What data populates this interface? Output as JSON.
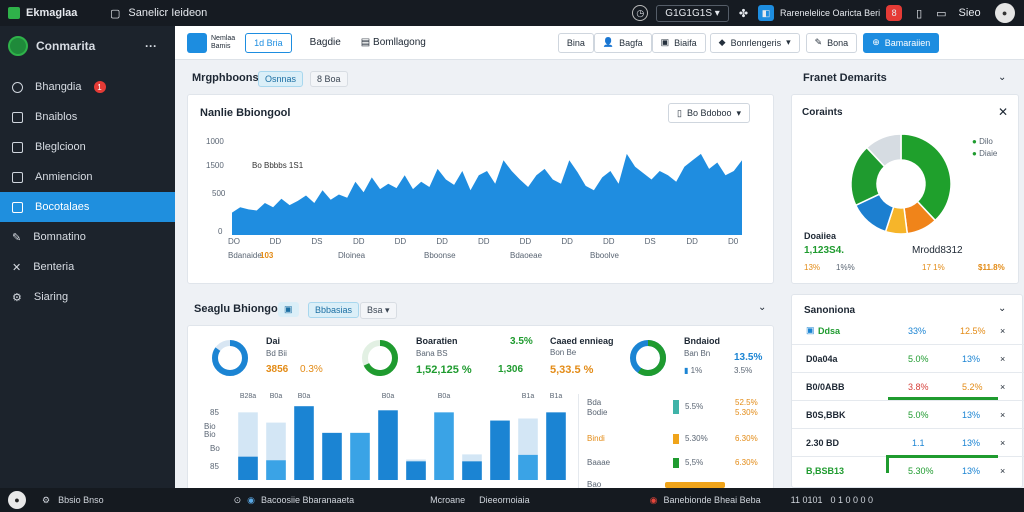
{
  "topbar": {
    "app_name": "Ekmaglaa",
    "search_label": "Sanelicr Ieideon",
    "dropdown_label": "G1G1G1S",
    "right_label": "Rarenelelice Oaricta Beri",
    "counter": "8",
    "user_label": "Sieo"
  },
  "sidebar": {
    "title": "Conmarita",
    "more": "···",
    "items": [
      {
        "label": "Bhangdia",
        "icon": "alert-icon",
        "badge": "1"
      },
      {
        "label": "Bnaiblos",
        "icon": "document-icon"
      },
      {
        "label": "Bleglcioon",
        "icon": "file-icon"
      },
      {
        "label": "Anmiencion",
        "icon": "box-icon"
      },
      {
        "label": "Bocotalaes",
        "icon": "chart-icon",
        "active": true
      },
      {
        "label": "Bomnatino",
        "icon": "tool-icon"
      },
      {
        "label": "Benteria",
        "icon": "cross-icon"
      },
      {
        "label": "Siaring",
        "icon": "gear-icon"
      }
    ]
  },
  "header": {
    "logo_line1": "Nemlaa",
    "logo_line2": "Bamis",
    "tab_active": "1d Bria",
    "tab2": "Bagdie",
    "tab3": "Bomllagong",
    "btn1": "Bina",
    "btn2": "Bagfa",
    "btn3": "Biaifa",
    "btn4": "Bonrlengeris",
    "btn5": "Bona",
    "primary_btn": "Bamaraiien"
  },
  "overview": {
    "title": "Mrgphboons",
    "chip1": "Osnnas",
    "chip2": "8 Boa",
    "panel_title": "Nanlie Bbiongool",
    "panel_select": "Bo Bdoboo",
    "y_ticks": [
      "1000",
      "1500",
      "500",
      "0"
    ],
    "annotation": "Bo Bbbbs 1S1",
    "x_ticks": [
      "DO",
      "DD",
      "DS",
      "DD",
      "DD",
      "DD",
      "DD",
      "DD",
      "DD",
      "DD",
      "DS",
      "DD",
      "D0"
    ],
    "footer_left": "Bdanaide",
    "footer_left_val": "103",
    "footer_mid": "Dloinea",
    "footer_r1": "Bboonse",
    "footer_r2": "Bdaoeae",
    "footer_r3": "Bboolve"
  },
  "chart_data": {
    "type": "area",
    "title": "Nanlie Bbiongool",
    "ylim": [
      0,
      1500
    ],
    "values": [
      210,
      260,
      240,
      230,
      300,
      260,
      340,
      280,
      320,
      370,
      300,
      420,
      330,
      380,
      350,
      500,
      400,
      540,
      430,
      480,
      440,
      560,
      430,
      500,
      450,
      620,
      520,
      470,
      600,
      420,
      560,
      600,
      480,
      700,
      600,
      520,
      450,
      560,
      620,
      520,
      480,
      700,
      590,
      460,
      420,
      540,
      600,
      480,
      760,
      640,
      580,
      520,
      600,
      560,
      500,
      640,
      700,
      760,
      620,
      680,
      560,
      600,
      700
    ]
  },
  "right_top": {
    "title": "Franet Demarits",
    "card_title": "Coraints",
    "legend1": "Dilo",
    "legend2": "Diaie",
    "legend1_color": "#1f9b2f",
    "legend2_color": "#1f9b2f",
    "slices": [
      {
        "value": 38,
        "color": "#1fa02c"
      },
      {
        "value": 10,
        "color": "#f0841a"
      },
      {
        "value": 7,
        "color": "#f6b52a"
      },
      {
        "value": 13,
        "color": "#1c7fd0"
      },
      {
        "value": 20,
        "color": "#1f9b2f"
      },
      {
        "value": 12,
        "color": "#d6dce2"
      }
    ],
    "stat_label1": "Doaiiea",
    "stat_val1": "1,123S4.",
    "stat_label2": "Mrodd8312",
    "sub1": "13%",
    "sub2": "1%%",
    "sub3": "17 1%",
    "sub4": "$11.8%"
  },
  "segments": {
    "title": "Seaglu Bhiongoo",
    "chip1": "Bbbasias",
    "chip2": "Bsa",
    "kpis": [
      {
        "label": "Dai",
        "sub": "Bd Bii",
        "v1": "3856",
        "v2": "0.3%",
        "ring": 85,
        "color": "#1b84d3"
      },
      {
        "label": "Boaratien",
        "sub": "Bana BS",
        "big": "1,52,125 %",
        "v1": "3.5%",
        "v2": "1,306",
        "ring": 68,
        "color": "#1f9b2f"
      },
      {
        "label": "Caaed ennieag",
        "sub": "Bon Be",
        "v1": "5,33.5 %",
        "ring": 0,
        "color": "#e38b16"
      },
      {
        "label": "Bndaiod",
        "sub": "Ban Bn",
        "v1": "13.5%",
        "v2": "3.5%",
        "v3": "1%",
        "ring": 60,
        "color": "#1f9b2f"
      }
    ]
  },
  "bars_data": {
    "type": "bar",
    "ylim": [
      0,
      80
    ],
    "y_ticks": [
      "85",
      "Bio",
      "Bio",
      "Bo",
      "85"
    ],
    "top_labels": [
      "B28a",
      "B0a",
      "B0a",
      "",
      "",
      "B0a",
      "",
      "B0a",
      "",
      "",
      "B1a",
      "B1a"
    ],
    "series": [
      {
        "name": "blue",
        "values": [
          65,
          55,
          72,
          46,
          46,
          68,
          52,
          66,
          52,
          58,
          70,
          66
        ]
      },
      {
        "name": "light",
        "values": [
          66,
          56,
          0,
          0,
          0,
          0,
          20,
          0,
          25,
          0,
          60,
          0
        ]
      }
    ]
  },
  "side_list": {
    "rows": [
      {
        "label": "Bda",
        "color": "#1f9b2f"
      },
      {
        "label": "Bodie",
        "color": "#1f9b2f"
      },
      {
        "label": "Bindi",
        "color": "#e38b16"
      },
      {
        "label": "Baaae",
        "color": "#1f9b2f"
      }
    ],
    "bar_values": [
      "52.5%",
      "5.5%",
      "5.30%",
      "5,5%"
    ],
    "bar_colors": [
      "#3fb3a8",
      "#1f9b2f",
      "#f0a41a",
      "#1f9b2f"
    ],
    "rbar_values": [
      "5.30%",
      "6.30%",
      "6.30%",
      "3.50%"
    ],
    "footer": "Bao"
  },
  "segments_table": {
    "title": "Sanoniona",
    "rows": [
      {
        "name": "Ddsa",
        "a": "33%",
        "b": "12.5%",
        "c": "×"
      },
      {
        "name": "D0a04a",
        "a": "5.0%",
        "b": "13%",
        "c": "×"
      },
      {
        "name": "B0/0ABB",
        "a": "3.8%",
        "b": "5.2%",
        "c": "×"
      },
      {
        "name": "B0S,BBK",
        "a": "5.0%",
        "b": "13%",
        "c": "×"
      },
      {
        "name": "2.30 BD",
        "a": "1.1",
        "b": "13%",
        "c": "×"
      },
      {
        "name": "B,BSB13",
        "a": "5.30%",
        "b": "13%",
        "c": "×"
      }
    ]
  },
  "statusbar": {
    "left": "Bbsio Bnso",
    "mid": "Bacoosiie Bbaranaaeta",
    "mid2": "Mcroane",
    "mid3": "Dieeornoiaia",
    "right": "Banebionde Bheai Beba",
    "time": "11 0101",
    "time2": "0 1 0 0 0 0"
  }
}
